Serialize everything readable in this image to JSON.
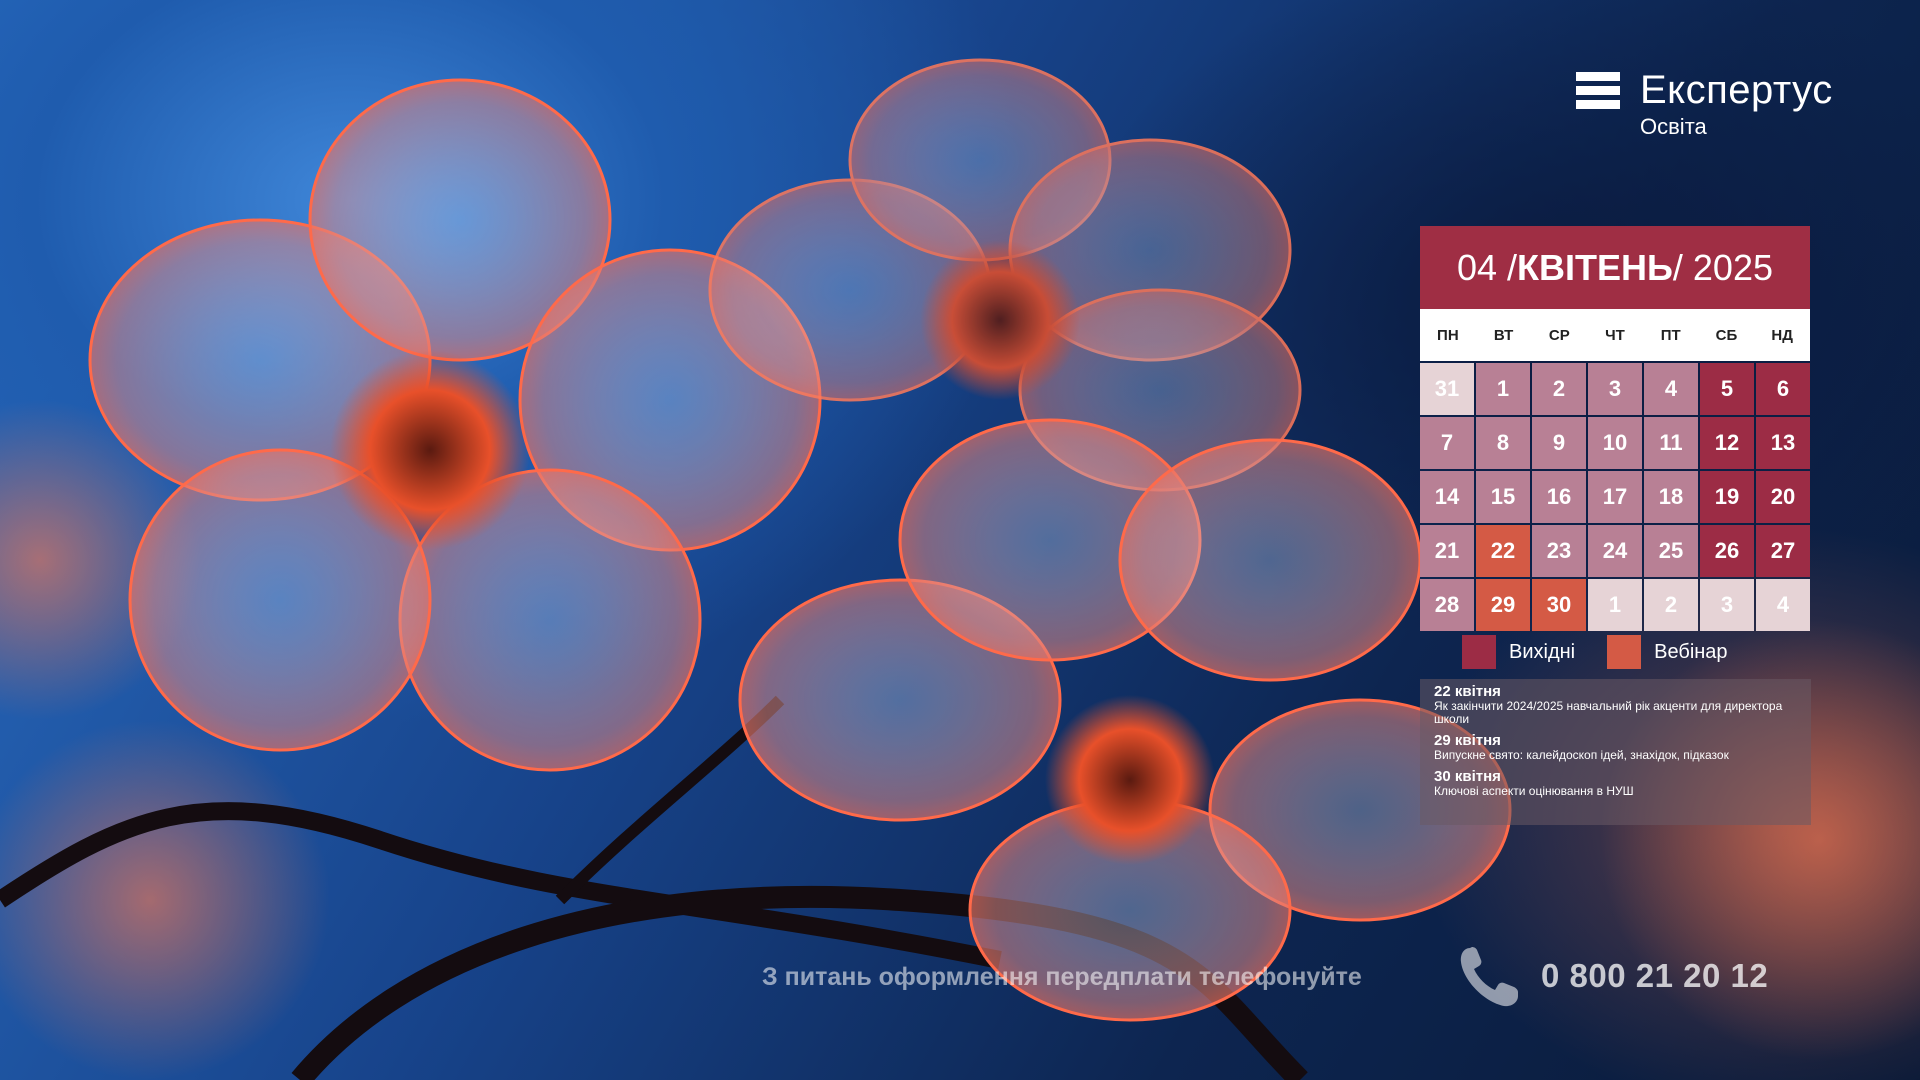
{
  "brand": {
    "name": "Експертус",
    "sub": "Освіта"
  },
  "calendar": {
    "month_num": "04 / ",
    "month_name": "КВІТЕНЬ",
    "year": "/ 2025",
    "weekdays": [
      "ПН",
      "ВТ",
      "СР",
      "ЧТ",
      "ПТ",
      "СБ",
      "НД"
    ],
    "days": [
      {
        "d": "31",
        "t": "other"
      },
      {
        "d": "1",
        "t": "work"
      },
      {
        "d": "2",
        "t": "work"
      },
      {
        "d": "3",
        "t": "work"
      },
      {
        "d": "4",
        "t": "work"
      },
      {
        "d": "5",
        "t": "weekend"
      },
      {
        "d": "6",
        "t": "weekend"
      },
      {
        "d": "7",
        "t": "work"
      },
      {
        "d": "8",
        "t": "work"
      },
      {
        "d": "9",
        "t": "work"
      },
      {
        "d": "10",
        "t": "work"
      },
      {
        "d": "11",
        "t": "work"
      },
      {
        "d": "12",
        "t": "weekend"
      },
      {
        "d": "13",
        "t": "weekend"
      },
      {
        "d": "14",
        "t": "work"
      },
      {
        "d": "15",
        "t": "work"
      },
      {
        "d": "16",
        "t": "work"
      },
      {
        "d": "17",
        "t": "work"
      },
      {
        "d": "18",
        "t": "work"
      },
      {
        "d": "19",
        "t": "weekend"
      },
      {
        "d": "20",
        "t": "weekend"
      },
      {
        "d": "21",
        "t": "work"
      },
      {
        "d": "22",
        "t": "web"
      },
      {
        "d": "23",
        "t": "work"
      },
      {
        "d": "24",
        "t": "work"
      },
      {
        "d": "25",
        "t": "work"
      },
      {
        "d": "26",
        "t": "weekend"
      },
      {
        "d": "27",
        "t": "weekend"
      },
      {
        "d": "28",
        "t": "work"
      },
      {
        "d": "29",
        "t": "web"
      },
      {
        "d": "30",
        "t": "web"
      },
      {
        "d": "1",
        "t": "other"
      },
      {
        "d": "2",
        "t": "other"
      },
      {
        "d": "3",
        "t": "other"
      },
      {
        "d": "4",
        "t": "other"
      }
    ]
  },
  "legend": {
    "weekend": "Вихідні",
    "webinar": "Вебінар"
  },
  "colors": {
    "weekend": "#9c2c45",
    "webinar": "#d45a45",
    "work": "#b88095",
    "header": "#9f2e44"
  },
  "events": [
    {
      "date": "22 квітня",
      "title": "Як закінчити 2024/2025 навчальний рік акценти для директора школи"
    },
    {
      "date": "29 квітня",
      "title": "Випускне свято: калейдоскоп ідей, знахідок, підказок"
    },
    {
      "date": "30 квітня",
      "title": "Ключові аспекти оцінювання в НУШ"
    }
  ],
  "footer": {
    "text": "З питань оформлення передплати телефонуйте",
    "phone": "0 800 21 20 12",
    "icon": "phone-icon"
  }
}
